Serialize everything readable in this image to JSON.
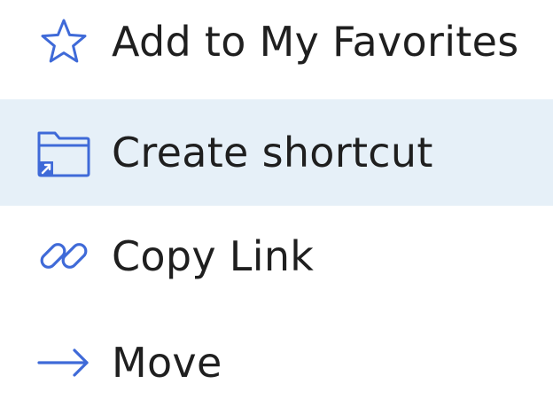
{
  "menu": {
    "accent_color": "#3f6ad8",
    "highlight_color": "#e6f0f8",
    "items": [
      {
        "label": "Add to My Favorites",
        "icon": "star-icon",
        "highlighted": false
      },
      {
        "label": "Create shortcut",
        "icon": "folder-shortcut-icon",
        "highlighted": true
      },
      {
        "label": "Copy Link",
        "icon": "link-icon",
        "highlighted": false
      },
      {
        "label": "Move",
        "icon": "arrow-right-icon",
        "highlighted": false
      }
    ]
  }
}
